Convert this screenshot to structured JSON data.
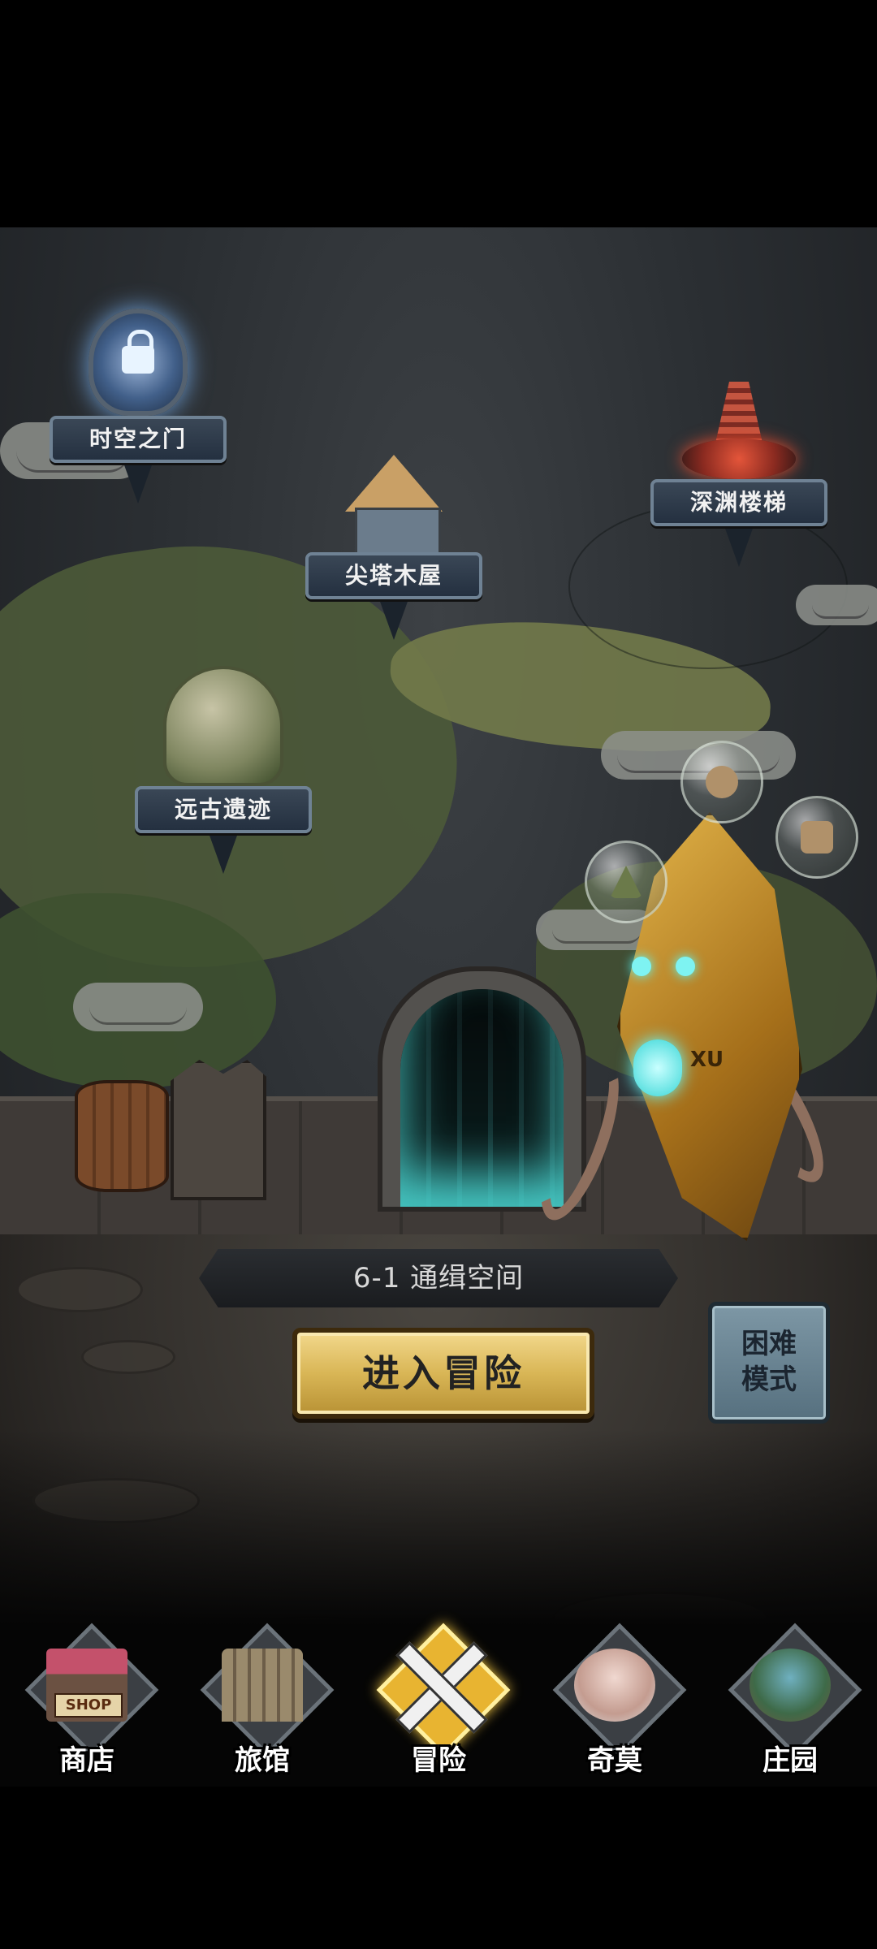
{
  "map": {
    "locations": [
      {
        "label": "时空之门",
        "locked": true,
        "icon": "lock-icon"
      },
      {
        "label": "深渊楼梯"
      },
      {
        "label": "尖塔木屋"
      },
      {
        "label": "远古遗迹"
      }
    ]
  },
  "boss": {
    "mark": "XU"
  },
  "stage": {
    "title": "6-1 通缉空间"
  },
  "buttons": {
    "enter_label": "进入冒险",
    "hard_mode_label": "困难模式"
  },
  "shop_sign": "SHOP",
  "nav": {
    "items": [
      {
        "label": "商店",
        "icon": "shop-icon"
      },
      {
        "label": "旅馆",
        "icon": "inn-icon"
      },
      {
        "label": "冒险",
        "icon": "crossed-swords-icon",
        "active": true
      },
      {
        "label": "奇莫",
        "icon": "monster-icon"
      },
      {
        "label": "庄园",
        "icon": "manor-icon"
      }
    ]
  },
  "colors": {
    "accent_gold": "#e8b431",
    "button_gold": "#d9b656",
    "hard_mode_blue": "#6b8696",
    "banner": "#2e3a48"
  }
}
